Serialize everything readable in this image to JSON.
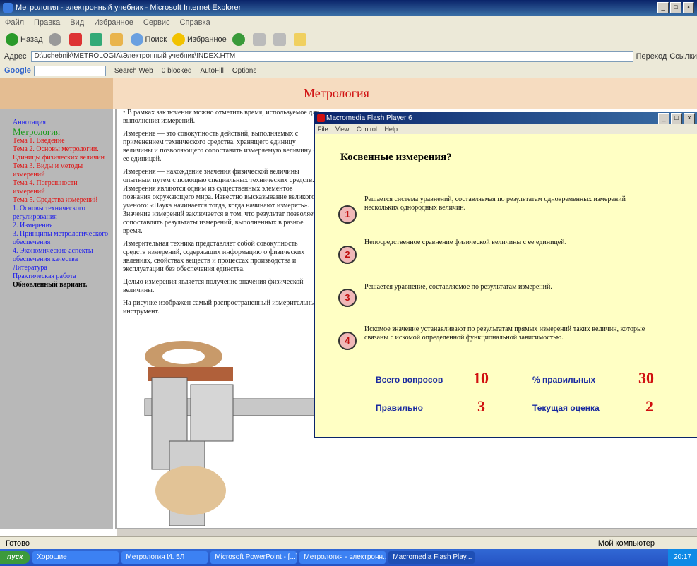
{
  "window": {
    "title": "Метрология - электронный учебник - Microsoft Internet Explorer"
  },
  "menubar": [
    "Файл",
    "Правка",
    "Вид",
    "Избранное",
    "Сервис",
    "Справка"
  ],
  "toolbar": {
    "back": "Назад",
    "search": "Поиск",
    "favorites": "Избранное"
  },
  "address": {
    "label": "Адрес",
    "url": "D:\\uchebnik\\METROLOGIA\\Электронный учебник\\INDEX.HTM",
    "go": "Переход",
    "links": "Ссылки"
  },
  "googlebar": {
    "logo": "Google",
    "search_web": "Search Web",
    "blocked": "0 blocked",
    "autofill": "AutoFill",
    "options": "Options"
  },
  "header": {
    "title": "Метрология"
  },
  "sidebar": {
    "items": [
      {
        "text": "Аннотация",
        "style": "blue"
      },
      {
        "text": "Метрология",
        "style": "green"
      },
      {
        "text": "Тема 1. Введение",
        "style": "red"
      },
      {
        "text": "Тема 2. Основы метрологии. Единицы физических величин",
        "style": "red"
      },
      {
        "text": "Тема 3. Виды и методы измерений",
        "style": "red"
      },
      {
        "text": "Тема 4. Погрешности измерений",
        "style": "red"
      },
      {
        "text": "Тема 5. Средства измерений",
        "style": "red"
      },
      {
        "text": "1. Основы технического регулирования",
        "style": "blue"
      },
      {
        "text": "2. Измерения",
        "style": "blue"
      },
      {
        "text": "3. Принципы метрологического обеспечения",
        "style": "blue"
      },
      {
        "text": "4. Экономические аспекты обеспечения качества",
        "style": "blue"
      },
      {
        "text": "Литература",
        "style": "blue"
      },
      {
        "text": "Практическая работа",
        "style": "blue"
      },
      {
        "text": "Обновленный вариант.",
        "style": "bold"
      }
    ]
  },
  "content": {
    "paragraphs": [
      "• В рамках заключения можно отметить время, используемое для выполнения измерений.",
      "Измерение — это совокупность действий, выполняемых с применением технического средства, хранящего единицу величины и позволяющего сопоставить измеряемую величину с ее единицей.",
      "Измерения — нахождение значения физической величины опытным путем с помощью специальных технических средств. Измерения являются одним из существенных элементов познания окружающего мира. Известно высказывание великого ученого: «Наука начинается тогда, когда начинают измерять». Значение измерений заключается в том, что результат позволяет сопоставлять результаты измерений, выполненных в разное время.",
      "Измерительная техника представляет собой совокупность средств измерений, содержащих информацию о физических явлениях, свойствах веществ и процессах производства и эксплуатации без обеспечения единства.",
      "Целью измерения является получение значения физической величины.",
      "На рисунке изображен самый распространенный измерительный инструмент."
    ]
  },
  "flash": {
    "title": "Macromedia Flash Player 6",
    "menu": [
      "File",
      "View",
      "Control",
      "Help"
    ],
    "question": "Косвенные измерения?",
    "answers": [
      {
        "num": "1",
        "text": "Решается система уравнений, составляемая по результатам одновременных измерений нескольких однородных величин."
      },
      {
        "num": "2",
        "text": "Непосредственное сравнение физической величины с ее единицей."
      },
      {
        "num": "3",
        "text": "Решается уравнение, составляемое по результатам измерений."
      },
      {
        "num": "4",
        "text": "Искомое значение устанавливают по результатам прямых измерений таких величин, которые связаны с искомой определенной функциональной зависимостью."
      }
    ],
    "stats": {
      "total_label": "Всего вопросов",
      "total": "10",
      "pct_label": "% правильных",
      "pct": "30",
      "right_label": "Правильно",
      "right": "3",
      "grade_label": "Текущая оценка",
      "grade": "2"
    }
  },
  "statusbar": {
    "left": "Готово",
    "right": "Мой компьютер"
  },
  "taskbar": {
    "start": "пуск",
    "buttons": [
      "Хорошие",
      "Метрология И. 5Л",
      "Microsoft PowerPoint - [...]",
      "Метрология - электронн...",
      "Macromedia Flash Play..."
    ],
    "clock": "20:17"
  }
}
